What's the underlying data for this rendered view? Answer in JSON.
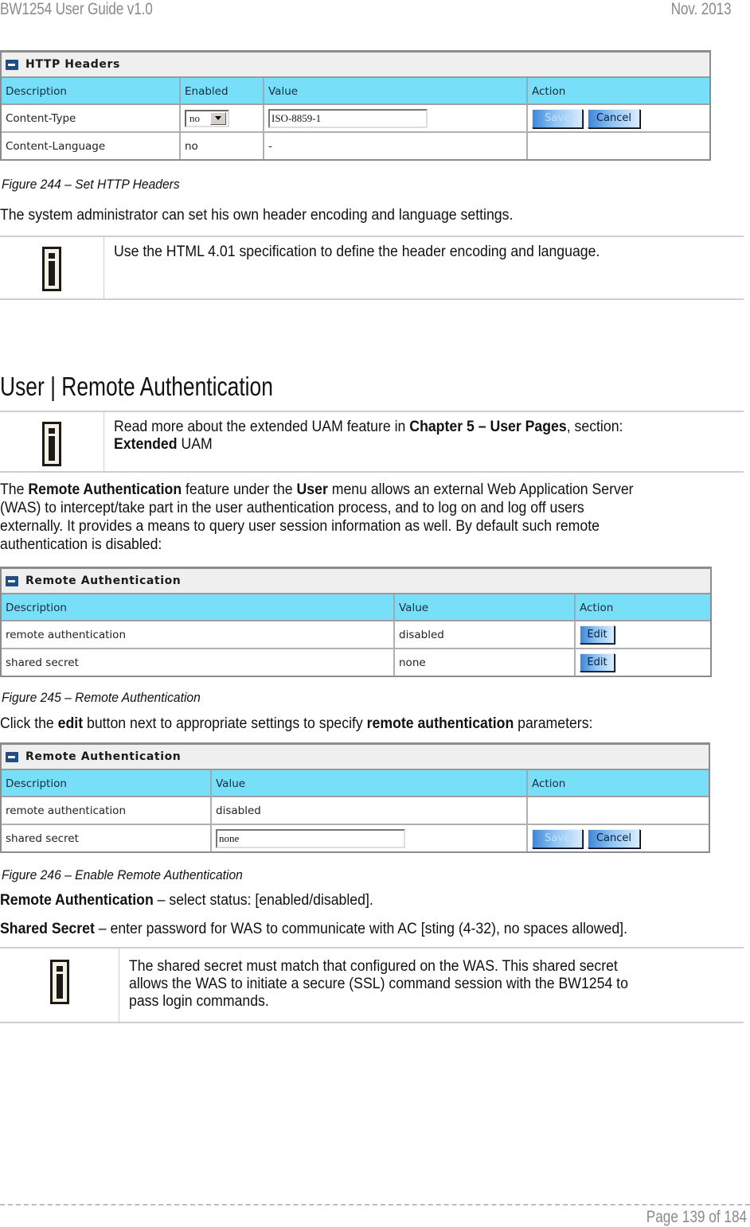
{
  "header": {
    "doc_title": "BW1254 User Guide v1.0",
    "date": "Nov.  2013"
  },
  "http_headers_table": {
    "title": "HTTP Headers",
    "columns": [
      "Description",
      "Enabled",
      "Value",
      "Action"
    ],
    "rows": [
      {
        "description": "Content-Type",
        "enabled_select": "no",
        "value_input": "ISO-8859-1",
        "save_label": "Save",
        "cancel_label": "Cancel"
      },
      {
        "description": "Content-Language",
        "enabled": "no",
        "value": "-"
      }
    ]
  },
  "figure_244": "Figure 244  – Set HTTP Headers",
  "para_admin": "The system administrator can set his own header encoding and language settings.",
  "note_1": "Use the HTML 4.01 specification to define the header encoding and language.",
  "section_title": "User | Remote Authentication",
  "note_2": {
    "t1": "Read more about the extended UAM feature in ",
    "b1": "Chapter 5 – User Pages",
    "t2": ", section:",
    "b2": "Extended",
    "t3": " UAM"
  },
  "para_intro": {
    "t1": "The ",
    "b1": "Remote Authentication",
    "t2": " feature under the ",
    "b2": "User",
    "t3": " menu allows an external Web Application Server",
    "line2": "(WAS) to intercept/take part in the user authentication process, and to log on and log off users",
    "line3": "externally. It provides a means to query user session information as well. By default such remote",
    "line4": "authentication is disabled:"
  },
  "remote_auth_table": {
    "title": "Remote Authentication",
    "columns": [
      "Description",
      "Value",
      "Action"
    ],
    "rows": [
      {
        "description": "remote authentication",
        "value": "disabled",
        "action_label": "Edit"
      },
      {
        "description": "shared secret",
        "value": "none",
        "action_label": "Edit"
      }
    ]
  },
  "figure_245": "Figure 245  – Remote Authentication",
  "para_click": {
    "t1": "Click the ",
    "b1": "edit",
    "t2": " button next to appropriate settings to specify ",
    "b2": "remote authentication",
    "t3": " parameters:"
  },
  "remote_auth_edit_table": {
    "title": "Remote Authentication",
    "columns": [
      "Description",
      "Value",
      "Action"
    ],
    "rows": [
      {
        "description": "remote authentication",
        "value": "disabled"
      },
      {
        "description": "shared secret",
        "value_input": "none",
        "save_label": "Save",
        "cancel_label": "Cancel"
      }
    ]
  },
  "figure_246": "Figure 246 – Enable Remote Authentication",
  "def_remote_auth": {
    "term": "Remote Authentication",
    "text": " – select status: [enabled/disabled]."
  },
  "def_shared_secret": {
    "term": "Shared Secret",
    "text": " – enter password for WAS to communicate with AC [sting (4-32), no spaces allowed]."
  },
  "note_3": {
    "line1": "The shared secret must match that configured on the WAS.  This shared secret",
    "line2": "allows the WAS to initiate a secure (SSL) command session with the BW1254 to",
    "line3": "pass login commands."
  },
  "footer": {
    "page": "Page 139 of 184"
  },
  "colors": {
    "table_header_bg": "#78dff9",
    "title_bar_bg": "#efefef",
    "header_text": "#8a8a8a"
  }
}
